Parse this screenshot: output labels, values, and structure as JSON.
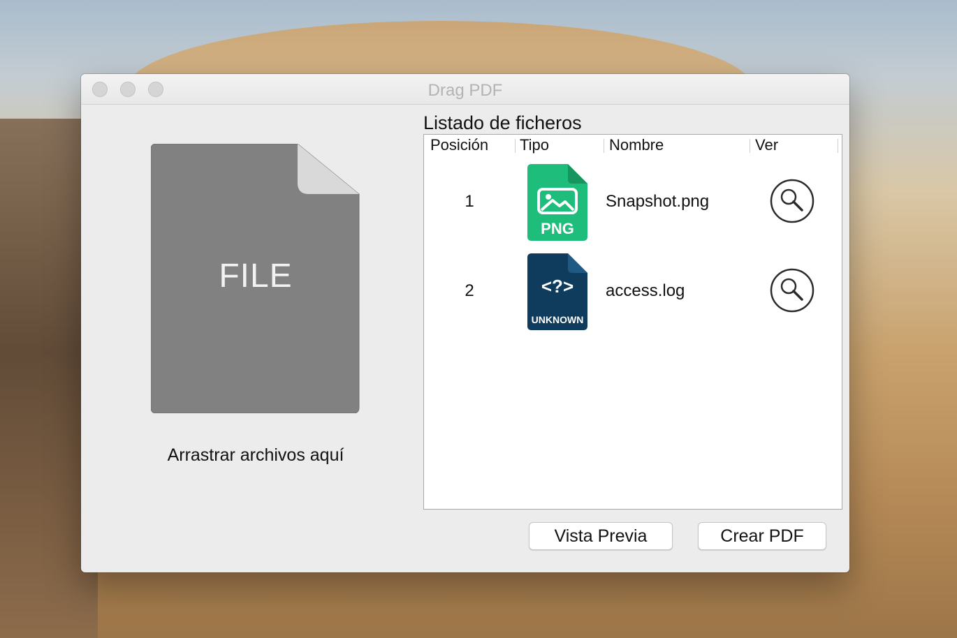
{
  "window": {
    "title": "Drag PDF"
  },
  "drop_zone": {
    "icon_label": "FILE",
    "hint": "Arrastrar archivos aquí",
    "icon": "file-icon"
  },
  "file_list": {
    "title": "Listado de ficheros",
    "columns": [
      "Posición",
      "Tipo",
      "Nombre",
      "Ver"
    ],
    "rows": [
      {
        "position": "1",
        "type_icon": "png-file-icon",
        "type_label": "PNG",
        "type_color": "#1fbd7b",
        "name": "Snapshot.png",
        "view_icon": "magnifier-icon"
      },
      {
        "position": "2",
        "type_icon": "unknown-file-icon",
        "type_label": "UNKNOWN",
        "type_glyph": "<?>",
        "type_color": "#0f3b5c",
        "name": "access.log",
        "view_icon": "magnifier-icon"
      }
    ]
  },
  "buttons": {
    "preview": "Vista Previa",
    "create_pdf": "Crear PDF"
  }
}
